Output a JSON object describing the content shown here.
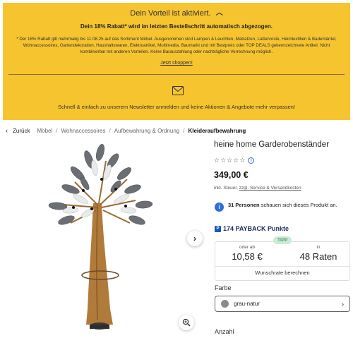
{
  "promo": {
    "headline": "Dein Vorteil ist aktiviert.",
    "subline": "Dein 18% Rabatt* wird im letzten Bestellschritt automatisch abgezogen.",
    "fineprint": "* Der 18% Rabatt gilt mehrmalig bis 11.08.25 auf das Sortiment Möbel. Ausgenommen sind Lampen & Leuchten, Matratzen, Lattenroste, Heimtextilien & Bademäntel, Wohnaccessoires, Gartendekoration, Haushaltswaren, Elektroartikel, Multimedia, Baumarkt und mit Bestpreis oder TOP DEALS gekennzeichnete Artikel. Nicht kombinierbar mit anderen Vorteilen. Keine Barauszahlung oder nachträgliche Verrechnung möglich.",
    "cta": "Jetzt shoppen!",
    "newsletter": "Schnell & einfach zu unserem Newsletter anmelden und keine Aktionen & Angebote mehr verpassen!"
  },
  "breadcrumb": {
    "back": "Zurück",
    "items": [
      "Möbel",
      "Wohnaccessoires",
      "Aufbewahrung & Ordnung"
    ],
    "current": "Kleideraufbewahrung"
  },
  "product": {
    "title": "heine home Garderobenständer",
    "rating": 0,
    "rating_max": 5,
    "price": "349,00 €",
    "tax_prefix": "inkl. Steuer, ",
    "tax_link": "zzgl. Service & Versandkosten",
    "watchers_count": "31 Personen",
    "watchers_text": " schauen sich dieses Produkt an.",
    "payback": "174 PAYBACK Punkte"
  },
  "financing": {
    "tipp": "TIPP",
    "from_label": "oder ab",
    "from_value": "10,58 €",
    "in_label": "in",
    "in_value": "48 Raten",
    "calc": "Wunschrate berechnen"
  },
  "color": {
    "label": "Farbe",
    "value": "grau-natur",
    "swatch": "#8a8a8a"
  },
  "quantity": {
    "label": "Anzahl"
  },
  "colors": {
    "banner": "#f6c42f",
    "payback": "#1a58b8",
    "info": "#2e6fd8",
    "tipp_bg": "#c9ecd4"
  }
}
